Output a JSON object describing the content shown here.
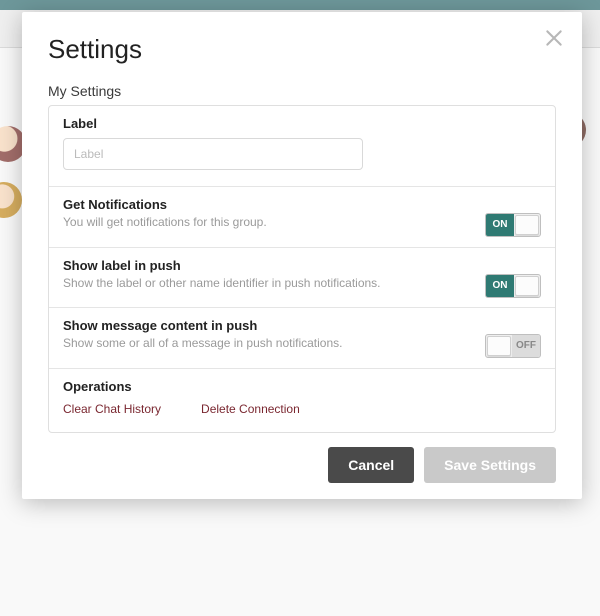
{
  "modal": {
    "title": "Settings",
    "subheader": "My Settings",
    "close_icon": "close"
  },
  "sections": {
    "label": {
      "title": "Label",
      "placeholder": "Label",
      "value": ""
    },
    "notifications": {
      "title": "Get Notifications",
      "desc": "You will get notifications for this group.",
      "state": "ON"
    },
    "label_push": {
      "title": "Show label in push",
      "desc": "Show the label or other name identifier in push notifications.",
      "state": "ON"
    },
    "content_push": {
      "title": "Show message content in push",
      "desc": "Show some or all of a message in push notifications.",
      "state": "OFF"
    },
    "operations": {
      "title": "Operations",
      "clear": "Clear Chat History",
      "delete": "Delete Connection"
    }
  },
  "actions": {
    "cancel": "Cancel",
    "save": "Save Settings"
  }
}
